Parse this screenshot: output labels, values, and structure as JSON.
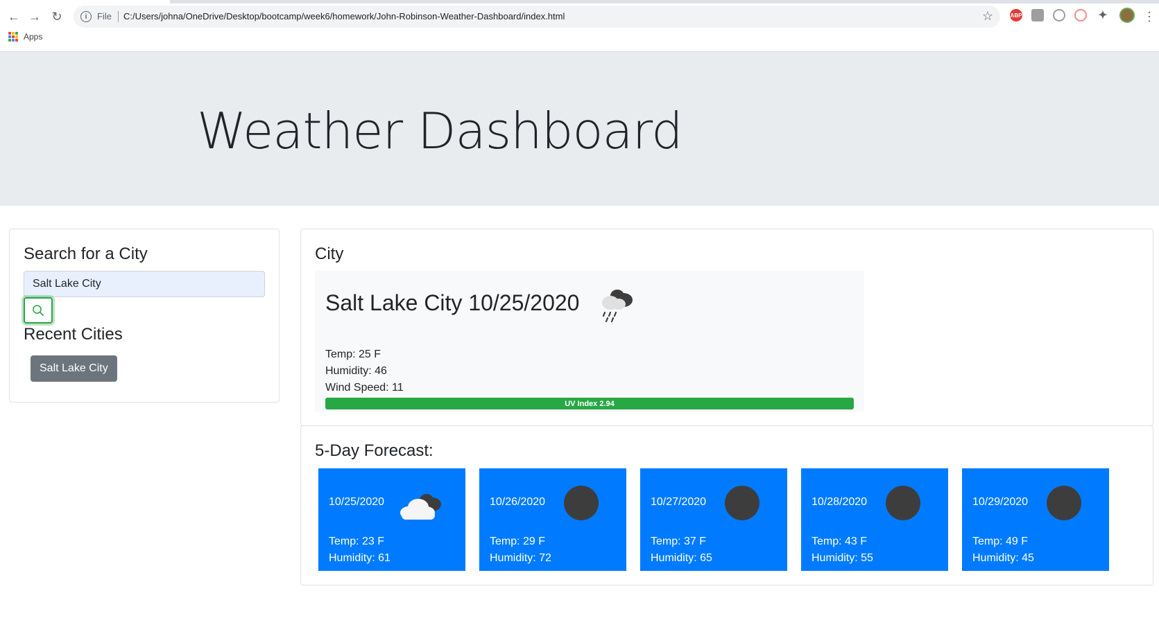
{
  "browser": {
    "file_label": "File",
    "url": "C:/Users/johna/OneDrive/Desktop/bootcamp/week6/homework/John-Robinson-Weather-Dashboard/index.html",
    "bookmarks_apps": "Apps",
    "abp_label": "ABP"
  },
  "header": {
    "title": "Weather Dashboard"
  },
  "search": {
    "heading": "Search for a City",
    "input_value": "Salt Lake City",
    "recent_heading": "Recent Cities",
    "recent": [
      "Salt Lake City"
    ]
  },
  "current": {
    "heading": "City",
    "title": "Salt Lake City 10/25/2020",
    "icon": "rain-cloud-icon",
    "temp": "Temp: 25 F",
    "humidity": "Humidity: 46",
    "wind": "Wind Speed: 11",
    "uv": "UV Index 2.94",
    "uv_color": "#28a745"
  },
  "forecast": {
    "heading": "5-Day Forecast:",
    "card_color": "#007bff",
    "days": [
      {
        "date": "10/25/2020",
        "icon": "cloud-icon",
        "temp": "Temp: 23 F",
        "humidity": "Humidity: 61"
      },
      {
        "date": "10/26/2020",
        "icon": "dark-circle-icon",
        "temp": "Temp: 29 F",
        "humidity": "Humidity: 72"
      },
      {
        "date": "10/27/2020",
        "icon": "dark-circle-icon",
        "temp": "Temp: 37 F",
        "humidity": "Humidity: 65"
      },
      {
        "date": "10/28/2020",
        "icon": "dark-circle-icon",
        "temp": "Temp: 43 F",
        "humidity": "Humidity: 55"
      },
      {
        "date": "10/29/2020",
        "icon": "dark-circle-icon",
        "temp": "Temp: 49 F",
        "humidity": "Humidity: 45"
      }
    ]
  }
}
